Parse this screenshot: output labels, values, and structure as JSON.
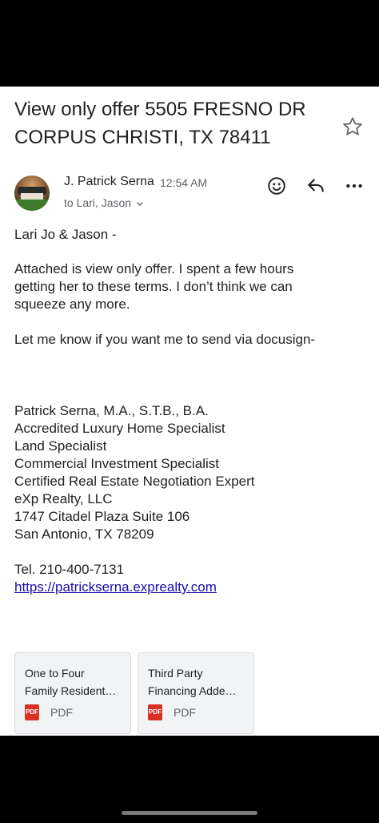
{
  "email": {
    "subject": "View only offer 5505 FRESNO DR CORPUS CHRISTI, TX 78411",
    "sender_name": "J. Patrick Serna",
    "time": "12:54 AM",
    "recipients": "to Lari, Jason",
    "body": {
      "greeting": "Lari Jo & Jason -",
      "para1": [
        "Attached is view only offer.  I spent a few hours",
        "getting her to these terms.  I don’t think we can",
        "squeeze any more."
      ],
      "para2": "Let me know if you want me to send via  docusign-",
      "signature": [
        "Patrick Serna, M.A., S.T.B., B.A.",
        "Accredited Luxury Home Specialist",
        "Land Specialist",
        "Commercial Investment Specialist",
        "Certified Real Estate Negotiation Expert",
        "eXp Realty, LLC",
        "1747 Citadel Plaza  Suite 106",
        "San Antonio, TX  78209"
      ],
      "tel": "Tel. 210-400-7131",
      "link": "https://patrickserna.exprealty.com"
    },
    "attachments": [
      {
        "name_line1": "One to Four",
        "name_line2": "Family Resident…",
        "type": "PDF",
        "badge": "PDF"
      },
      {
        "name_line1": "Third Party",
        "name_line2": "Financing Adde…",
        "type": "PDF",
        "badge": "PDF"
      }
    ]
  },
  "icons": {
    "star": "star-outline-icon",
    "emoji": "smiley-icon",
    "reply": "reply-arrow-icon",
    "more": "more-horizontal-icon",
    "chevron": "chevron-down-icon",
    "pdf": "pdf-file-icon"
  },
  "colors": {
    "text": "#202124",
    "secondary": "#5f6368",
    "link": "#1a0dab",
    "pdf_red": "#d93025",
    "card_bg": "#f1f3f4"
  }
}
